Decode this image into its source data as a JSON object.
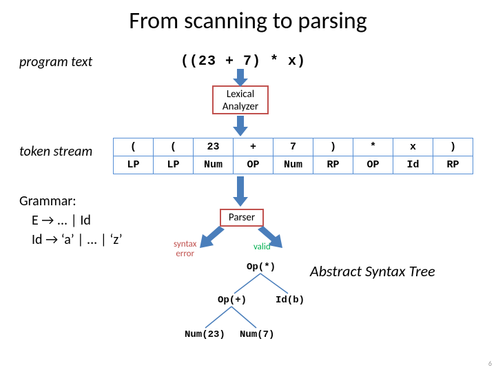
{
  "title": "From scanning to parsing",
  "labels": {
    "program_text": "program text",
    "token_stream": "token stream",
    "ast": "Abstract Syntax Tree"
  },
  "program": "((23 + 7) * x)",
  "boxes": {
    "lexical_analyzer_l1": "Lexical",
    "lexical_analyzer_l2": "Analyzer",
    "parser": "Parser"
  },
  "tokens": {
    "row1": [
      "(",
      "(",
      "23",
      "+",
      "7",
      ")",
      "*",
      "x",
      ")"
    ],
    "row2": [
      "LP",
      "LP",
      "Num",
      "OP",
      "Num",
      "RP",
      "OP",
      "Id",
      "RP"
    ]
  },
  "grammar": {
    "title": "Grammar:",
    "line2": "E → ... | Id",
    "line3": "Id → ‘a’ | ... | ‘z’"
  },
  "syntax_error_l1": "syntax",
  "syntax_error_l2": "error",
  "valid": "valid",
  "tree": {
    "n1": "Op(*)",
    "n2": "Op(+)",
    "n3": "Id(b)",
    "n4": "Num(23)",
    "n5": "Num(7)"
  },
  "page": "6"
}
